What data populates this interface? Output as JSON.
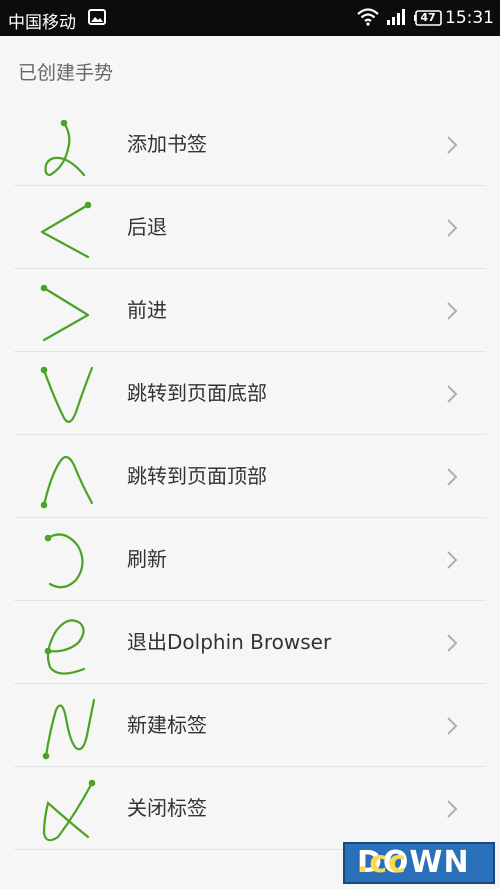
{
  "status_bar": {
    "carrier": "中国移动",
    "battery": "47",
    "time": "15:31"
  },
  "page": {
    "section_title": "已创建手势"
  },
  "gestures": [
    {
      "label": "添加书签",
      "icon": "gesture-a-icon"
    },
    {
      "label": "后退",
      "icon": "gesture-less-than-icon"
    },
    {
      "label": "前进",
      "icon": "gesture-greater-than-icon"
    },
    {
      "label": "跳转到页面底部",
      "icon": "gesture-v-icon"
    },
    {
      "label": "跳转到页面顶部",
      "icon": "gesture-caret-icon"
    },
    {
      "label": "刷新",
      "icon": "gesture-refresh-icon"
    },
    {
      "label": "退出Dolphin Browser",
      "icon": "gesture-e-icon"
    },
    {
      "label": "新建标签",
      "icon": "gesture-n-icon"
    },
    {
      "label": "关闭标签",
      "icon": "gesture-x-icon"
    }
  ],
  "colors": {
    "gesture_stroke": "#4aa324",
    "status_bar_bg": "#0c0c0c",
    "chevron": "#b0b0b0"
  },
  "watermark": {
    "text": "DOWN",
    "suffix": ".cc"
  }
}
